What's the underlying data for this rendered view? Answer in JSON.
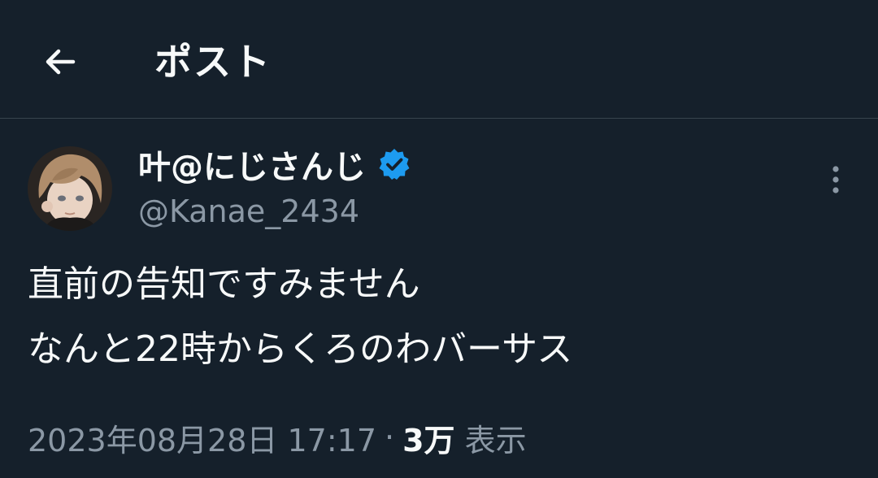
{
  "header": {
    "title": "ポスト",
    "back_icon": "arrow-left-icon"
  },
  "tweet": {
    "author": {
      "display_name": "叶@にじさんじ",
      "handle": "@Kanae_2434",
      "verified": true,
      "verified_color": "#1d9bf0"
    },
    "lines": [
      "直前の告知ですみません",
      "なんと22時からくろのわバーサス"
    ],
    "timestamp": "2023年08月28日 17:17",
    "separator": "·",
    "views_count": "3万",
    "views_label": "表示"
  },
  "colors": {
    "background": "#15202b",
    "text_primary": "#f7f9f9",
    "text_secondary": "#8b98a5",
    "divider": "#38444d"
  }
}
